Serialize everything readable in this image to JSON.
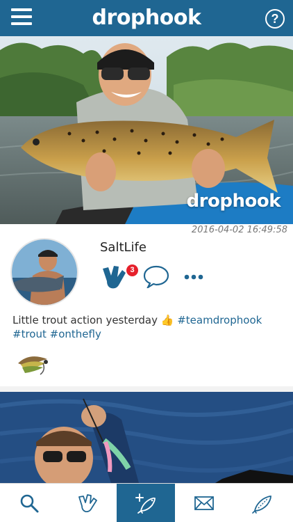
{
  "app": {
    "title": "drophook",
    "help_label": "?"
  },
  "post": {
    "watermark": "drophook",
    "timestamp": "2016-04-02 16:49:58",
    "username": "SaltLife",
    "likes_count": "3",
    "caption": {
      "text": "Little trout action yesterday ",
      "emoji": "👍",
      "hashtags": [
        "#teamdrophook",
        "#trout",
        "#onthefly"
      ]
    }
  },
  "tabs": [
    {
      "label": "Search",
      "icon": "search-icon",
      "active": false
    },
    {
      "label": "Hooks",
      "icon": "hook-hand-icon",
      "active": false
    },
    {
      "label": "Add catch",
      "icon": "add-fish-icon",
      "active": true
    },
    {
      "label": "Messages",
      "icon": "envelope-icon",
      "active": false
    },
    {
      "label": "Measure",
      "icon": "fish-ruler-icon",
      "active": false
    }
  ],
  "colors": {
    "brand": "#1f6692",
    "badge": "#e6202b",
    "hashtag": "#1f6692"
  }
}
